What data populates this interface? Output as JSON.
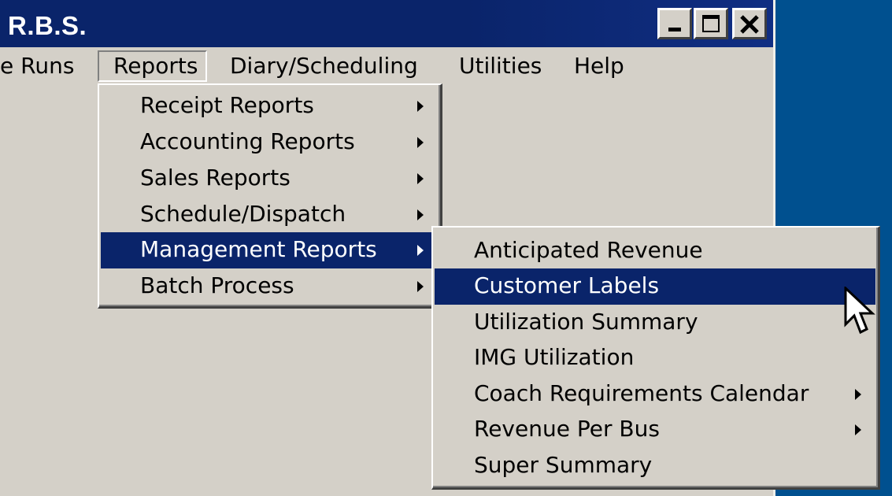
{
  "window": {
    "title": "R.B.S."
  },
  "menubar": {
    "items": [
      {
        "label": "e Runs"
      },
      {
        "label": "Reports"
      },
      {
        "label": "Diary/Scheduling"
      },
      {
        "label": "Utilities"
      },
      {
        "label": "Help"
      }
    ]
  },
  "reports_menu": {
    "items": [
      {
        "label": "Receipt Reports",
        "submenu": true
      },
      {
        "label": "Accounting Reports",
        "submenu": true
      },
      {
        "label": "Sales Reports",
        "submenu": true
      },
      {
        "label": "Schedule/Dispatch",
        "submenu": true
      },
      {
        "label": "Management Reports",
        "submenu": true,
        "highlighted": true
      },
      {
        "label": "Batch Process",
        "submenu": true
      }
    ]
  },
  "management_menu": {
    "items": [
      {
        "label": "Anticipated Revenue",
        "submenu": false
      },
      {
        "label": "Customer Labels",
        "submenu": false,
        "highlighted": true
      },
      {
        "label": "Utilization Summary",
        "submenu": false
      },
      {
        "label": "IMG Utilization",
        "submenu": false
      },
      {
        "label": "Coach Requirements Calendar",
        "submenu": true
      },
      {
        "label": "Revenue Per Bus",
        "submenu": true
      },
      {
        "label": "Super Summary",
        "submenu": false
      }
    ]
  },
  "colors": {
    "titlebar": "#0a246a",
    "highlight": "#0a246a",
    "face": "#d4d0c8",
    "desktop": "#00508f"
  },
  "icons": {
    "minimize": "minimize-icon",
    "maximize": "maximize-icon",
    "close": "close-icon",
    "submenu_arrow": "submenu-arrow-icon",
    "cursor": "mouse-pointer-icon"
  }
}
